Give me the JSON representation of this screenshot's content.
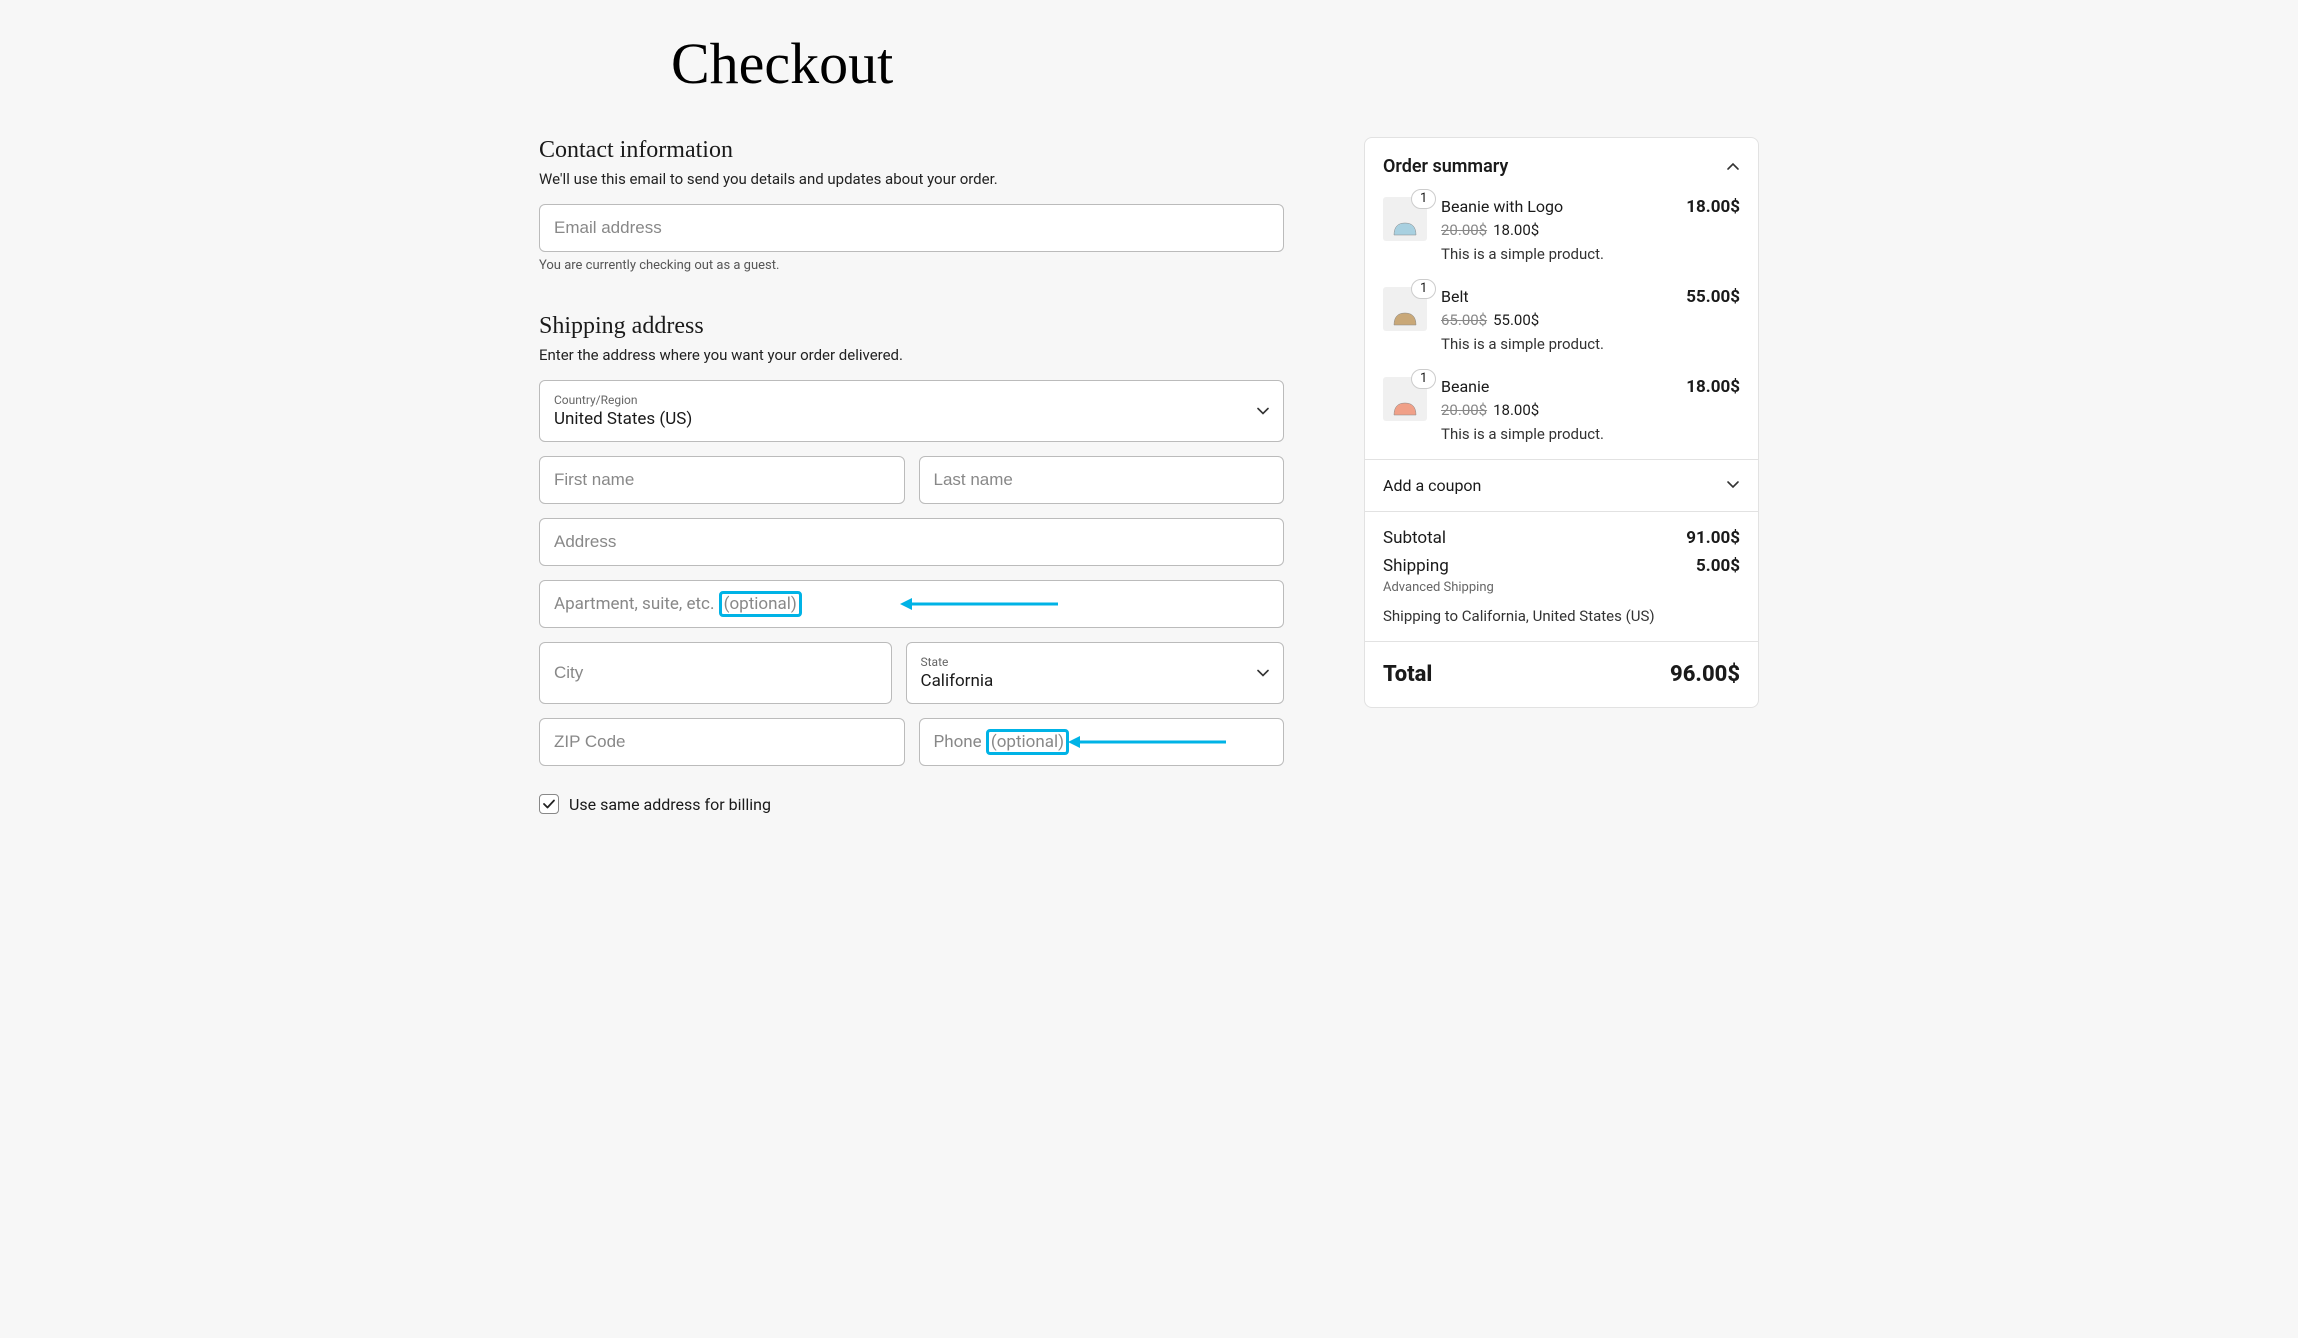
{
  "page_title": "Checkout",
  "contact": {
    "heading": "Contact information",
    "desc": "We'll use this email to send you details and updates about your order.",
    "email_placeholder": "Email address",
    "guest_note": "You are currently checking out as a guest."
  },
  "shipping": {
    "heading": "Shipping address",
    "desc": "Enter the address where you want your order delivered.",
    "country_label": "Country/Region",
    "country_value": "United States (US)",
    "first_name_placeholder": "First name",
    "last_name_placeholder": "Last name",
    "address_placeholder": "Address",
    "apt_placeholder": "Apartment, suite, etc. ",
    "optional_text": "(optional)",
    "city_placeholder": "City",
    "state_label": "State",
    "state_value": "California",
    "zip_placeholder": "ZIP Code",
    "phone_placeholder": "Phone ",
    "same_billing_label": "Use same address for billing"
  },
  "summary": {
    "title": "Order summary",
    "coupon_label": "Add a coupon",
    "subtotal_label": "Subtotal",
    "subtotal_value": "91.00$",
    "shipping_label": "Shipping",
    "shipping_value": "5.00$",
    "shipping_method": "Advanced Shipping",
    "shipping_to": "Shipping to California, United States (US)",
    "total_label": "Total",
    "total_value": "96.00$",
    "items": [
      {
        "qty": "1",
        "name": "Beanie with Logo",
        "price": "18.00$",
        "orig": "20.00$",
        "sale": "18.00$",
        "desc": "This is a simple product.",
        "color": "#a8d0e0"
      },
      {
        "qty": "1",
        "name": "Belt",
        "price": "55.00$",
        "orig": "65.00$",
        "sale": "55.00$",
        "desc": "This is a simple product.",
        "color": "#c9a878"
      },
      {
        "qty": "1",
        "name": "Beanie",
        "price": "18.00$",
        "orig": "20.00$",
        "sale": "18.00$",
        "desc": "This is a simple product.",
        "color": "#f0a088"
      }
    ]
  }
}
